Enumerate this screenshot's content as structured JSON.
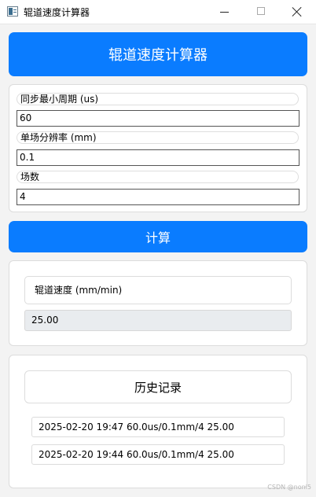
{
  "window": {
    "title": "辊道速度计算器",
    "controls": [
      "minimize",
      "maximize",
      "close"
    ]
  },
  "header": {
    "title": "辊道速度计算器",
    "color": "#0a7cff"
  },
  "inputs": {
    "sync_period_label": "同步最小周期 (us)",
    "sync_period_value": "60",
    "resolution_label": "单场分辨率 (mm)",
    "resolution_value": "0.1",
    "fields_label": "场数",
    "fields_value": "4"
  },
  "calculate_button": "计算",
  "result": {
    "label": "辊道速度 (mm/min)",
    "value": "25.00"
  },
  "history": {
    "title": "历史记录",
    "items": [
      "2025-02-20 19:47  60.0us/0.1mm/4  25.00",
      "2025-02-20 19:44  60.0us/0.1mm/4  25.00"
    ]
  },
  "watermark": "CSDN @noni5"
}
